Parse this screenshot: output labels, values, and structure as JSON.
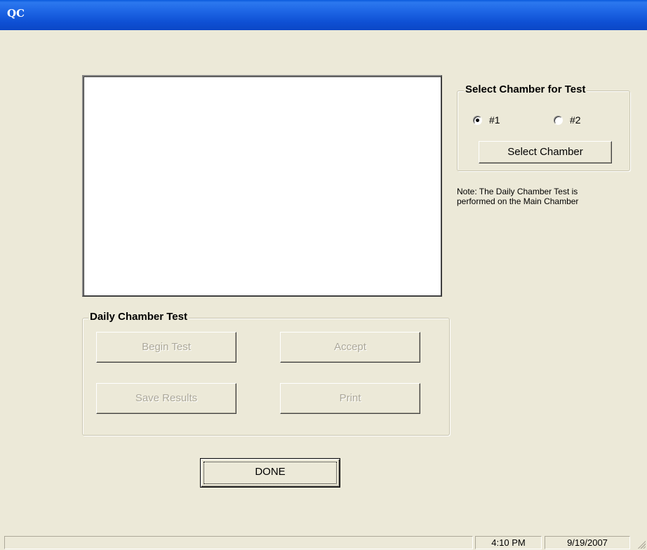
{
  "window": {
    "title": "QC"
  },
  "daily_chamber_test": {
    "legend": "Daily Chamber Test",
    "begin_test_label": "Begin Test",
    "accept_label": "Accept",
    "save_results_label": "Save Results",
    "print_label": "Print"
  },
  "select_chamber": {
    "legend": "Select Chamber for Test",
    "options": [
      {
        "label": "#1",
        "selected": true
      },
      {
        "label": "#2",
        "selected": false
      }
    ],
    "button_label": "Select Chamber",
    "note": "Note:  The Daily Chamber Test is\nperformed on the Main Chamber"
  },
  "done_label": "DONE",
  "statusbar": {
    "main": "",
    "time": "4:10 PM",
    "date": "9/19/2007"
  }
}
